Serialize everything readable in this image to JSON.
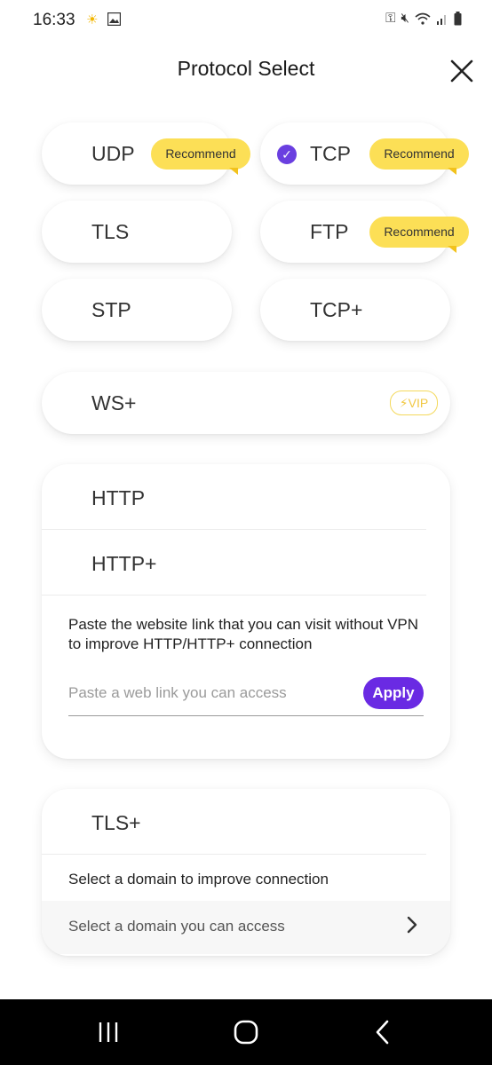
{
  "status_bar": {
    "time": "16:33"
  },
  "header": {
    "title": "Protocol Select"
  },
  "protocols": {
    "udp": {
      "label": "UDP",
      "badge": "Recommend"
    },
    "tcp": {
      "label": "TCP",
      "badge": "Recommend",
      "selected": true
    },
    "tls": {
      "label": "TLS"
    },
    "ftp": {
      "label": "FTP",
      "badge": "Recommend"
    },
    "stp": {
      "label": "STP"
    },
    "tcp_plus": {
      "label": "TCP+"
    },
    "ws_plus": {
      "label": "WS+",
      "vip": "VIP"
    }
  },
  "http_card": {
    "http_label": "HTTP",
    "http_plus_label": "HTTP+",
    "description": "Paste the website link that you can visit without VPN to improve HTTP/HTTP+ connection",
    "input_placeholder": "Paste a web link you can access",
    "input_value": "",
    "apply_label": "Apply"
  },
  "tls_plus_card": {
    "label": "TLS+",
    "description": "Select a domain to improve connection",
    "domain_selector": "Select a domain you can access"
  },
  "colors": {
    "accent_purple": "#6a2ae3",
    "badge_yellow": "#fcdf56",
    "vip_gold": "#f1c843"
  },
  "icons": {
    "close": "close-icon",
    "check": "check-circle-icon",
    "chevron": "chevron-right-icon",
    "vip": "lightning-icon"
  }
}
